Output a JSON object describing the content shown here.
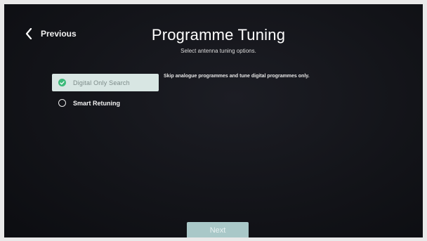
{
  "header": {
    "back_label": "Previous",
    "title": "Programme Tuning",
    "subtitle": "Select antenna tuning options."
  },
  "options": [
    {
      "label": "Digital Only Search",
      "selected": true
    },
    {
      "label": "Smart Retuning",
      "selected": false
    }
  ],
  "description": "Skip analogue programmes and tune digital programmes only.",
  "footer": {
    "next_label": "Next"
  },
  "colors": {
    "accent_green": "#3dba7a",
    "selected_bg": "#d8e6e3",
    "next_button_bg": "#a9c8c8",
    "screen_bg": "#131419"
  },
  "icons": {
    "back": "chevron-left-icon",
    "selected": "check-circle-icon",
    "unselected": "radio-empty-icon"
  }
}
